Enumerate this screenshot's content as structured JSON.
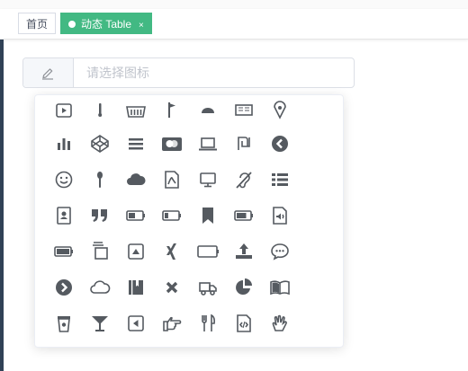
{
  "tags": {
    "home_label": "首页",
    "active_label": "动态 Table",
    "close_glyph": "×"
  },
  "search": {
    "placeholder": "请选择图标",
    "value": ""
  },
  "colors": {
    "accent": "#42b983",
    "icon": "#555a60"
  },
  "icons": [
    [
      "youtube-play-icon",
      "thermometer-icon",
      "shopping-basket-icon",
      "flag-icon",
      "motorcycle-helmet-icon",
      "newspaper-icon",
      "map-marker-icon"
    ],
    [
      "bar-chart-icon",
      "codepen-icon",
      "bars-icon",
      "cc-mastercard-icon",
      "laptop-icon",
      "shekel-icon",
      "chevron-circle-left-icon"
    ],
    [
      "smile-icon",
      "spoon-icon",
      "cloud-icon",
      "file-pdf-icon",
      "desktop-icon",
      "deaf-icon",
      "list-icon"
    ],
    [
      "address-book-icon",
      "quote-right-icon",
      "battery-half-icon",
      "battery-quarter-icon",
      "bookmark-icon",
      "battery-three-quarters-icon",
      "file-audio-icon"
    ],
    [
      "battery-full-icon",
      "clone-icon",
      "caret-square-up-icon",
      "xing-icon",
      "battery-empty-icon",
      "upload-icon",
      "comment-dots-icon"
    ],
    [
      "chevron-circle-right-icon",
      "cloud-outline-icon",
      "book-icon",
      "times-icon",
      "truck-icon",
      "pie-chart-icon",
      "book-open-icon"
    ],
    [
      "coffee-cup-icon",
      "glass-icon",
      "caret-square-left-icon",
      "hand-point-right-icon",
      "cutlery-icon",
      "file-code-icon",
      "hand-spock-icon"
    ]
  ]
}
